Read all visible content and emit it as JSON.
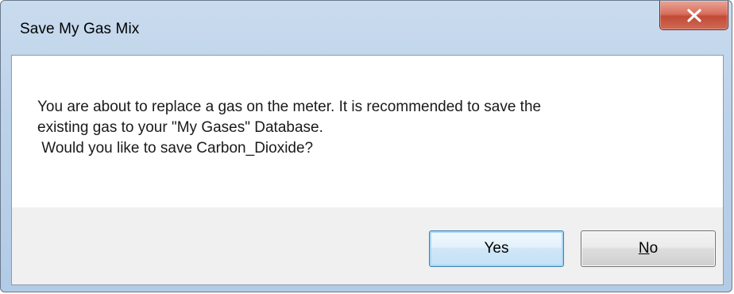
{
  "dialog": {
    "title": "Save My Gas Mix",
    "close_icon": "close-icon",
    "message": "You are about to replace a gas on the meter. It is recommended to save the\nexisting gas to your \"My Gases\" Database.\n Would you like to save Carbon_Dioxide?",
    "buttons": {
      "yes_label": "Yes",
      "no_mnemonic": "N",
      "no_rest": "o"
    }
  },
  "colors": {
    "close_button": "#c8503c",
    "titlebar": "#bcd2ea",
    "default_button_border": "#3c7fb1"
  }
}
